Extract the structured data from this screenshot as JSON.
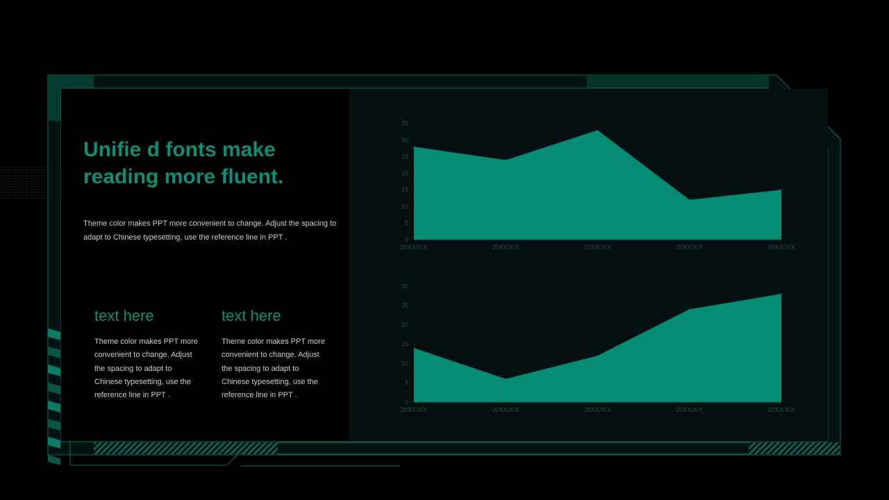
{
  "slide": {
    "title": "Unifie d fonts make reading more fluent.",
    "subtitle": "Theme color makes PPT more convenient to change. Adjust the spacing to adapt to Chinese typesetting, use the reference line in PPT .",
    "columns": [
      {
        "heading": "text here",
        "body": "Theme color makes PPT more convenient to change. Adjust the spacing to adapt to Chinese typesetting, use the reference line in PPT ."
      },
      {
        "heading": "text here",
        "body": "Theme color makes PPT more convenient to change. Adjust the spacing to adapt to Chinese typesetting, use the reference line in PPT ."
      }
    ]
  },
  "colors": {
    "accent": "#068c74",
    "title": "#0f8e76",
    "frame": "#0e6e5c",
    "panel_dark": "#03100f",
    "background": "#000000",
    "tick_text": "#2f4946"
  },
  "chart_data": [
    {
      "type": "area",
      "categories": [
        "20XX/X/X",
        "20XX/X/X",
        "20XX/X/X",
        "20XX/X/X",
        "20XX/X/X"
      ],
      "series": [
        {
          "values": [
            28,
            24,
            33,
            12,
            15
          ]
        }
      ],
      "ylim": [
        0,
        35
      ],
      "yticks": [
        0,
        5,
        10,
        15,
        20,
        25,
        30,
        35
      ],
      "grid": false,
      "legend": "none",
      "color": "#068c74"
    },
    {
      "type": "area",
      "categories": [
        "20XX/X/X",
        "20XX/X/X",
        "20XX/X/X",
        "20XX/X/X",
        "20XX/X/X"
      ],
      "series": [
        {
          "values": [
            14,
            6,
            12,
            24,
            28
          ]
        }
      ],
      "ylim": [
        0,
        30
      ],
      "yticks": [
        0,
        5,
        10,
        15,
        20,
        25,
        30
      ],
      "grid": false,
      "legend": "none",
      "color": "#068c74"
    }
  ]
}
